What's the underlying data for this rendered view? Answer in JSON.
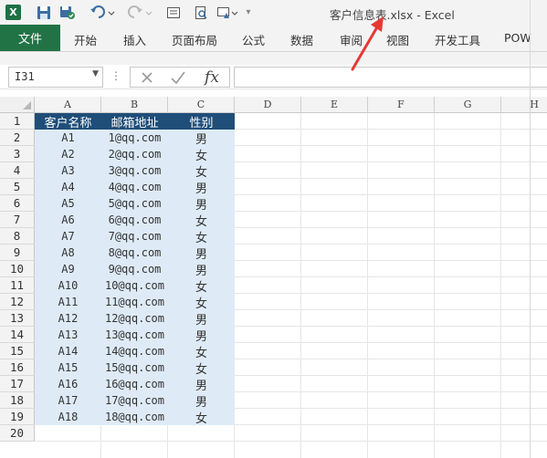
{
  "window": {
    "title": "客户信息表.xlsx - Excel",
    "app_icon": "excel-icon"
  },
  "quick_access": {
    "save": "save-icon",
    "autosave": "sync-save-icon",
    "undo": "undo-icon",
    "redo": "redo-icon",
    "form": "form-icon",
    "print_preview": "print-preview-icon",
    "touch": "touch-mode-icon",
    "customize": "customize-dropdown-icon"
  },
  "ribbon": {
    "file": "文件",
    "tabs": [
      "开始",
      "插入",
      "页面布局",
      "公式",
      "数据",
      "审阅",
      "视图",
      "开发工具",
      "POW"
    ]
  },
  "formula_bar": {
    "name_box": "I31",
    "cancel_icon": "cancel-x-icon",
    "enter_icon": "checkmark-icon",
    "fx_label": "fx",
    "formula": ""
  },
  "sheet": {
    "columns": [
      "A",
      "B",
      "C",
      "D",
      "E",
      "F",
      "G",
      "H"
    ],
    "row_numbers": [
      "1",
      "2",
      "3",
      "4",
      "5",
      "6",
      "7",
      "8",
      "9",
      "10",
      "11",
      "12",
      "13",
      "14",
      "15",
      "16",
      "17",
      "18",
      "19",
      "20"
    ],
    "header": [
      "客户名称",
      "邮箱地址",
      "性别"
    ],
    "rows": [
      [
        "A1",
        "1@qq.com",
        "男"
      ],
      [
        "A2",
        "2@qq.com",
        "女"
      ],
      [
        "A3",
        "3@qq.com",
        "女"
      ],
      [
        "A4",
        "4@qq.com",
        "男"
      ],
      [
        "A5",
        "5@qq.com",
        "男"
      ],
      [
        "A6",
        "6@qq.com",
        "女"
      ],
      [
        "A7",
        "7@qq.com",
        "女"
      ],
      [
        "A8",
        "8@qq.com",
        "男"
      ],
      [
        "A9",
        "9@qq.com",
        "男"
      ],
      [
        "A10",
        "10@qq.com",
        "女"
      ],
      [
        "A11",
        "11@qq.com",
        "女"
      ],
      [
        "A12",
        "12@qq.com",
        "男"
      ],
      [
        "A13",
        "13@qq.com",
        "男"
      ],
      [
        "A14",
        "14@qq.com",
        "女"
      ],
      [
        "A15",
        "15@qq.com",
        "女"
      ],
      [
        "A16",
        "16@qq.com",
        "男"
      ],
      [
        "A17",
        "17@qq.com",
        "男"
      ],
      [
        "A18",
        "18@qq.com",
        "女"
      ]
    ]
  },
  "colors": {
    "excel_green": "#217346",
    "header_fill": "#1f4e79",
    "data_fill": "#deebf7",
    "annotation_arrow": "#e53935"
  }
}
